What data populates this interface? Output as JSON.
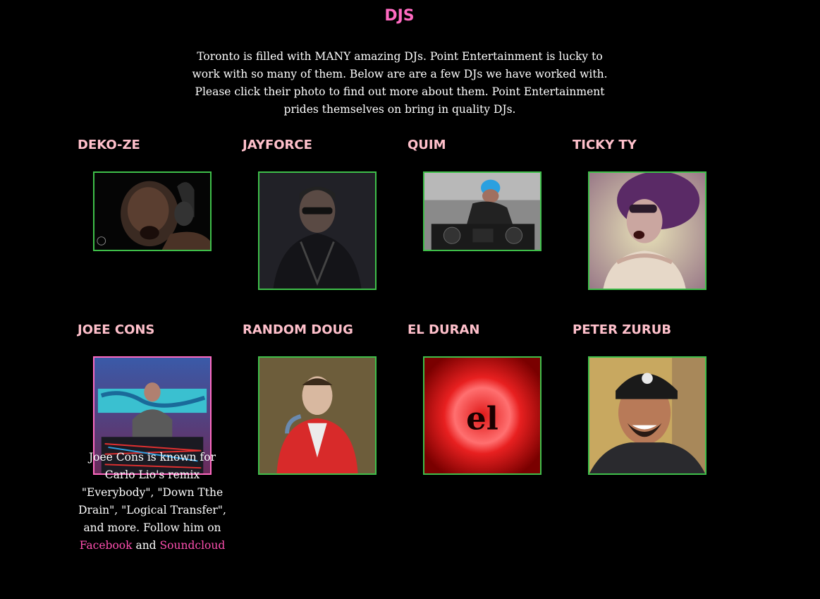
{
  "page": {
    "title": "DJS",
    "intro": "Toronto is filled with MANY amazing DJs. Point Entertainment is lucky to work with so many of them. Below are are a few DJs we have worked with. Please click their photo to find out more about them. Point Entertainment prides themselves on bring in quality DJs."
  },
  "djs": [
    {
      "name": "DEKO-ZE"
    },
    {
      "name": "JAYFORCE"
    },
    {
      "name": "QUIM"
    },
    {
      "name": "TICKY TY"
    },
    {
      "name": "JOEE CONS",
      "bio": "Joee Cons is known for Carlo Lio's remix \"Everybody\", \"Down Tthe Drain\", \"Logical Transfer\", and more. Follow him on",
      "link1": "Facebook",
      "and": "and",
      "link2": "Soundcloud"
    },
    {
      "name": "RANDOM DOUG"
    },
    {
      "name": "EL DURAN",
      "logo_text": "el"
    },
    {
      "name": "PETER ZURUB"
    }
  ],
  "colors": {
    "title": "#ff6ac1",
    "name": "#ffc0cb",
    "photo_border": "#3fbf4a",
    "photo_border_active": "#ff6ac1",
    "link": "#ff4fb0"
  }
}
